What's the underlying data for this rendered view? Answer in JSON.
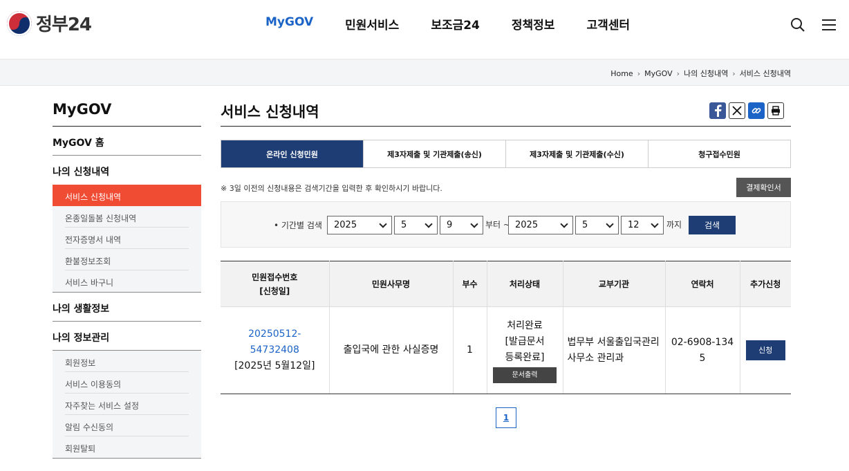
{
  "header": {
    "logo_text": "정부24",
    "nav": [
      "MyGOV",
      "민원서비스",
      "보조금24",
      "정책정보",
      "고객센터"
    ]
  },
  "breadcrumb": [
    "Home",
    "MyGOV",
    "나의 신청내역",
    "서비스 신청내역"
  ],
  "sidebar": {
    "title": "MyGOV",
    "home": "MyGOV 홈",
    "group1": "나의 신청내역",
    "group1_items": [
      "서비스 신청내역",
      "온종일돌봄 신청내역",
      "전자증명서 내역",
      "환불정보조회",
      "서비스 바구니"
    ],
    "group2": "나의 생활정보",
    "group3": "나의 정보관리",
    "group3_items": [
      "회원정보",
      "서비스 이용동의",
      "자주찾는 서비스 설정",
      "알림 수신동의",
      "회원탈퇴"
    ]
  },
  "main": {
    "title": "서비스 신청내역",
    "tabs": [
      "온라인 신청민원",
      "제3자제출 및 기관제출(송신)",
      "제3자제출 및 기관제출(수신)",
      "청구접수민원"
    ],
    "notice": "※ 3일 이전의 신청내용은 검색기간을 입력한 후 확인하시기 바랍니다.",
    "receipt_button": "결제확인서",
    "filter": {
      "label": "• 기간별 검색",
      "from_year": "2025",
      "from_month": "5",
      "from_day": "9",
      "from_text": "부터 ~",
      "to_year": "2025",
      "to_month": "5",
      "to_day": "12",
      "to_text": "까지",
      "search_button": "검색"
    },
    "table": {
      "headers": [
        "민원접수번호",
        "[신청일]",
        "민원사무명",
        "부수",
        "처리상태",
        "교부기관",
        "연락처",
        "추가신청"
      ],
      "row": {
        "receipt_no": "20250512-54732408",
        "date": "[2025년 5월12일]",
        "name": "출입국에 관한 사실증명",
        "count": "1",
        "status1": "처리완료",
        "status2": "[발급문서",
        "status3": "등록완료]",
        "print_button": "문서출력",
        "agency1": "법무부 서울출입국관리",
        "agency2": "사무소 관리과",
        "contact1": "02-6908-134",
        "contact2": "5",
        "apply_button": "신청"
      }
    },
    "page": "1"
  }
}
